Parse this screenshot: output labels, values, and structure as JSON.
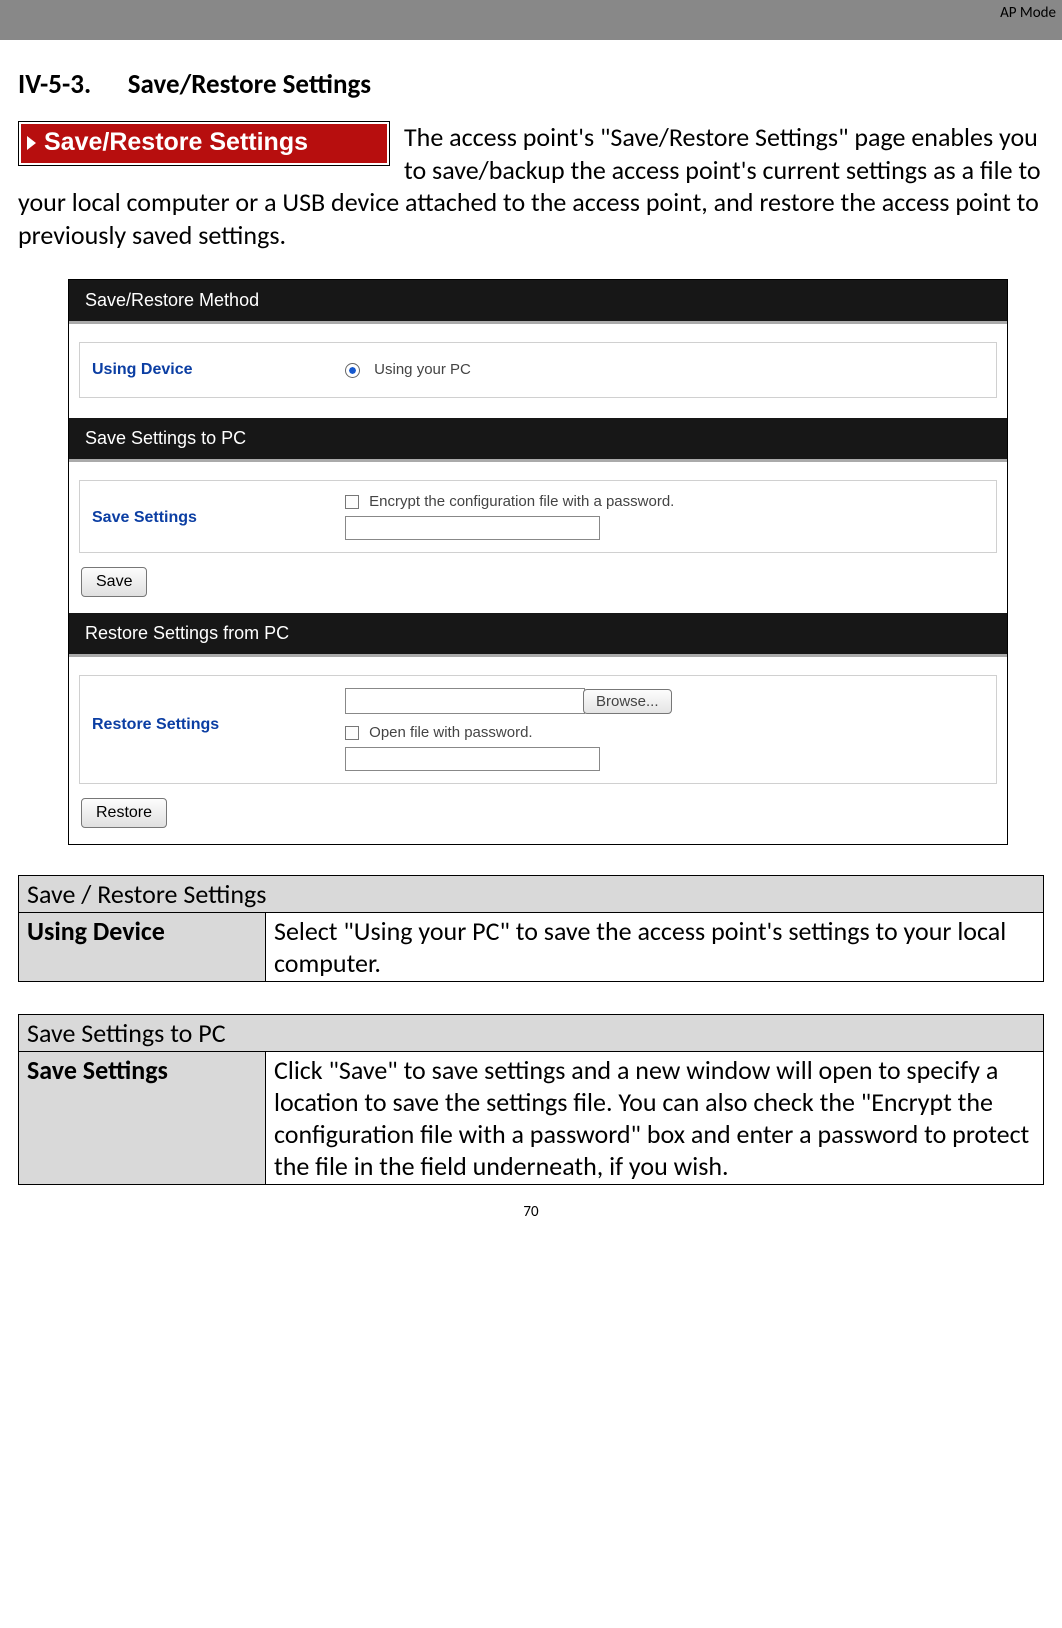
{
  "header": {
    "mode_label": "AP Mode"
  },
  "section": {
    "heading_num": "IV-5-3.",
    "heading_title": "Save/Restore Settings"
  },
  "badge": {
    "text": "Save/Restore Settings"
  },
  "intro": {
    "text": "The access point's \"Save/Restore Settings\" page enables you to save/backup the access point's current settings as a file to your local computer or a USB device attached to the access point, and restore the access point to previously saved settings."
  },
  "ui": {
    "method": {
      "header": "Save/Restore Method",
      "label": "Using Device",
      "option": "Using your PC"
    },
    "save": {
      "header": "Save Settings to PC",
      "label": "Save Settings",
      "encrypt_label": "Encrypt the configuration file with a password.",
      "button": "Save"
    },
    "restore": {
      "header": "Restore Settings from PC",
      "label": "Restore Settings",
      "browse": "Browse...",
      "open_label": "Open file with password.",
      "button": "Restore"
    }
  },
  "tables": {
    "t1": {
      "title": "Save / Restore Settings",
      "row_label": "Using Device",
      "row_desc": "Select \"Using your PC\" to save the access point's settings to your local computer."
    },
    "t2": {
      "title": "Save Settings to PC",
      "row_label": "Save Settings",
      "row_desc": "Click \"Save\" to save settings and a new window will open to specify a location to save the settings file. You can also check the \"Encrypt the configuration file with a password\" box and enter a password to protect the file in the field underneath, if you wish."
    }
  },
  "page_number": "70"
}
